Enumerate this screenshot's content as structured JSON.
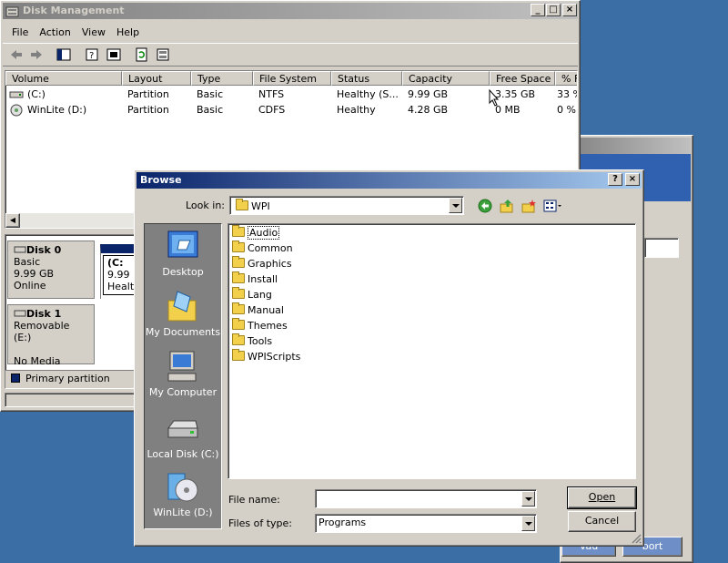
{
  "disk_mgmt": {
    "title": "Disk Management",
    "menu": [
      "File",
      "Action",
      "View",
      "Help"
    ],
    "columns": [
      "Volume",
      "Layout",
      "Type",
      "File System",
      "Status",
      "Capacity",
      "Free Space",
      "% Fr"
    ],
    "rows": [
      [
        "(C:)",
        "Partition",
        "Basic",
        "NTFS",
        "Healthy (S...",
        "9.99 GB",
        "3.35 GB",
        "33 %"
      ],
      [
        "WinLite (D:)",
        "Partition",
        "Basic",
        "CDFS",
        "Healthy",
        "4.28 GB",
        "0 MB",
        "0 %"
      ]
    ],
    "disks": [
      {
        "name": "Disk 0",
        "l1": "Basic",
        "l2": "9.99 GB",
        "l3": "Online"
      },
      {
        "name": "Disk 1",
        "l1": "Removable (E:)",
        "l2": "",
        "l3": "No Media"
      }
    ],
    "partition": {
      "name": "(C:",
      "size": "9.99",
      "status": "Healt"
    },
    "legend": "Primary partition"
  },
  "browse": {
    "title": "Browse",
    "look_in_label": "Look in:",
    "look_in_value": "WPI",
    "places": [
      "Desktop",
      "My Documents",
      "My Computer",
      "Local Disk (C:)",
      "WinLite (D:)"
    ],
    "folders": [
      "Audio",
      "Common",
      "Graphics",
      "Install",
      "Lang",
      "Manual",
      "Themes",
      "Tools",
      "WPIScripts"
    ],
    "file_name_label": "File name:",
    "file_name_value": "",
    "file_type_label": "Files of type:",
    "file_type_value": "Programs",
    "open_button": "Open",
    "cancel_button": "Cancel"
  },
  "bg_window": {
    "button1": "Vau",
    "button2": "bort"
  },
  "colors": {
    "desktop": "#3a6ea5",
    "active_title": "#0a246a",
    "face": "#d4d0c8",
    "places_bar": "#808080"
  }
}
